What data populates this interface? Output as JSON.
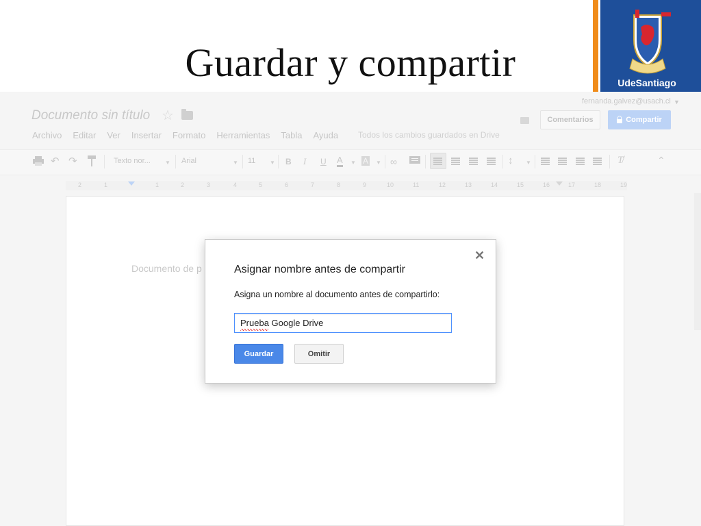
{
  "slide": {
    "title": "Guardar y compartir"
  },
  "logo": {
    "text": "UdeSantiago"
  },
  "docs": {
    "doc_title": "Documento sin título",
    "user_email": "fernanda.galvez@usach.cl",
    "comments_label": "Comentarios",
    "share_label": "Compartir",
    "menu": [
      "Archivo",
      "Editar",
      "Ver",
      "Insertar",
      "Formato",
      "Herramientas",
      "Tabla",
      "Ayuda"
    ],
    "save_status": "Todos los cambios guardados en Drive",
    "toolbar": {
      "style_select": "Texto nor...",
      "font_select": "Arial",
      "size_select": "11"
    },
    "ruler_numbers": [
      "2",
      "1",
      "1",
      "2",
      "3",
      "4",
      "5",
      "6",
      "7",
      "8",
      "9",
      "10",
      "11",
      "12",
      "13",
      "14",
      "15",
      "16",
      "17",
      "18",
      "19"
    ],
    "page_text": "Documento de p"
  },
  "dialog": {
    "title": "Asignar nombre antes de compartir",
    "message": "Asigna un nombre al documento antes de compartirlo:",
    "input_value": "Prueba Google Drive",
    "save_label": "Guardar",
    "skip_label": "Omitir"
  }
}
